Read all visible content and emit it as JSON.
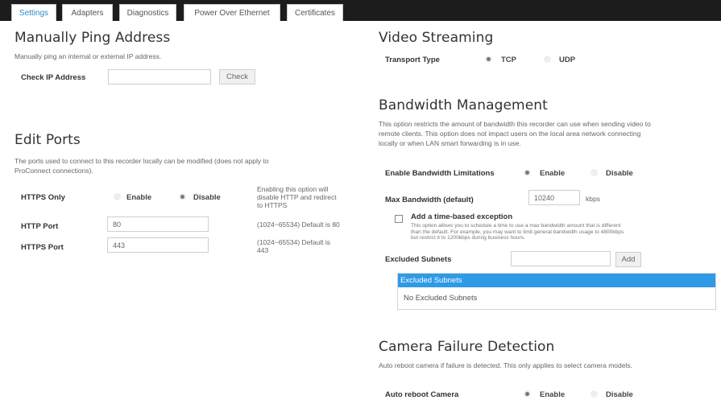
{
  "tabs": [
    "Settings",
    "Adapters",
    "Diagnostics",
    "Power Over Ethernet",
    "Certificates"
  ],
  "ping": {
    "title": "Manually Ping Address",
    "description": "Manually ping an internal or external IP address.",
    "label": "Check IP Address",
    "value": "",
    "button": "Check"
  },
  "ports": {
    "title": "Edit Ports",
    "description_line1": "The ports used to connect to this recorder locally can be modified (does not apply to",
    "description_line2": "ProConnect connections).",
    "https_only_label": "HTTPS Only",
    "enable": "Enable",
    "disable": "Disable",
    "https_only_selected": "Disable",
    "https_note_1": "Enabling this option will",
    "https_note_2": "disable HTTP and redirect",
    "https_note_3": "to HTTPS",
    "http_port_label": "HTTP Port",
    "http_port_value": "80",
    "http_port_hint": "(1024~65534) Default is 80",
    "https_port_label": "HTTPS Port",
    "https_port_value": "443",
    "https_port_hint_1": "(1024~65534) Default is",
    "https_port_hint_2": "443"
  },
  "video": {
    "title": "Video Streaming",
    "transport_label": "Transport Type",
    "tcp": "TCP",
    "udp": "UDP",
    "selected": "TCP"
  },
  "bandwidth": {
    "title": "Bandwidth Management",
    "description_line1": "This option restricts the amount of bandwidth this recorder can use when sending video to",
    "description_line2": "remote clients. This option does not impact users on the local area network connecting",
    "description_line3": "locally or when LAN smart forwarding is in use.",
    "limit_label": "Enable Bandwidth Limitations",
    "enable": "Enable",
    "disable": "Disable",
    "limit_selected": "Enable",
    "max_label": "Max Bandwidth (default)",
    "max_value": "10240",
    "max_unit": "kbps",
    "exception_label": "Add a time-based exception",
    "exception_checked": false,
    "exception_help_1": "This option allows you to schedule a time to use a max bandwidth amount that is different",
    "exception_help_2": "than the default. For example, you may want to limit general bandwidth usage to 4800kbps",
    "exception_help_3": "but restrict it to 1200kbps during business hours.",
    "excluded_label": "Excluded Subnets",
    "excluded_value": "",
    "add_button": "Add",
    "table_header": "Excluded Subnets",
    "table_empty": "No Excluded Subnets"
  },
  "camera": {
    "title": "Camera Failure Detection",
    "description": "Auto reboot camera if failure is detected. This only applies to select camera models.",
    "reboot_label": "Auto reboot Camera",
    "enable": "Enable",
    "disable": "Disable",
    "selected": "Enable"
  }
}
